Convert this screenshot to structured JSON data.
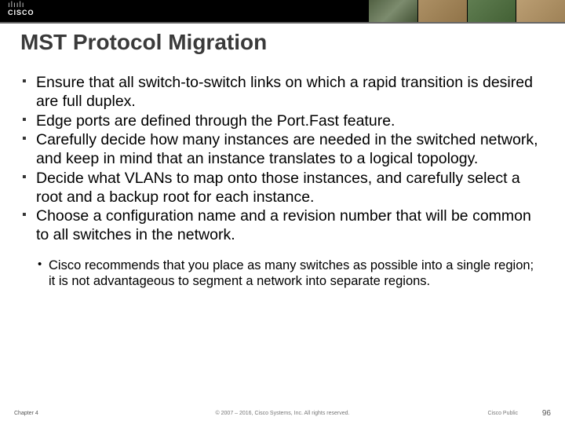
{
  "header": {
    "logo_bars": "ılıılı",
    "logo_text": "CISCO"
  },
  "title": "MST Protocol Migration",
  "bullets": [
    "Ensure that all switch-to-switch links on which a rapid transition is desired are full duplex.",
    "Edge ports are defined through the Port.Fast feature.",
    "Carefully decide how many instances are needed in the switched network, and keep in mind that an instance translates to a logical topology.",
    "Decide what VLANs to map onto those instances, and carefully select a root and a backup root for each instance.",
    "Choose a configuration name and a revision number that will be common to all switches in the network."
  ],
  "sub_bullets": [
    "Cisco recommends that you place as many switches as possible into a single region; it is not advantageous to segment a network into separate regions."
  ],
  "footer": {
    "chapter": "Chapter 4",
    "copyright": "© 2007 – 2016, Cisco Systems, Inc. All rights reserved.",
    "pub": "Cisco Public",
    "page": "96"
  }
}
